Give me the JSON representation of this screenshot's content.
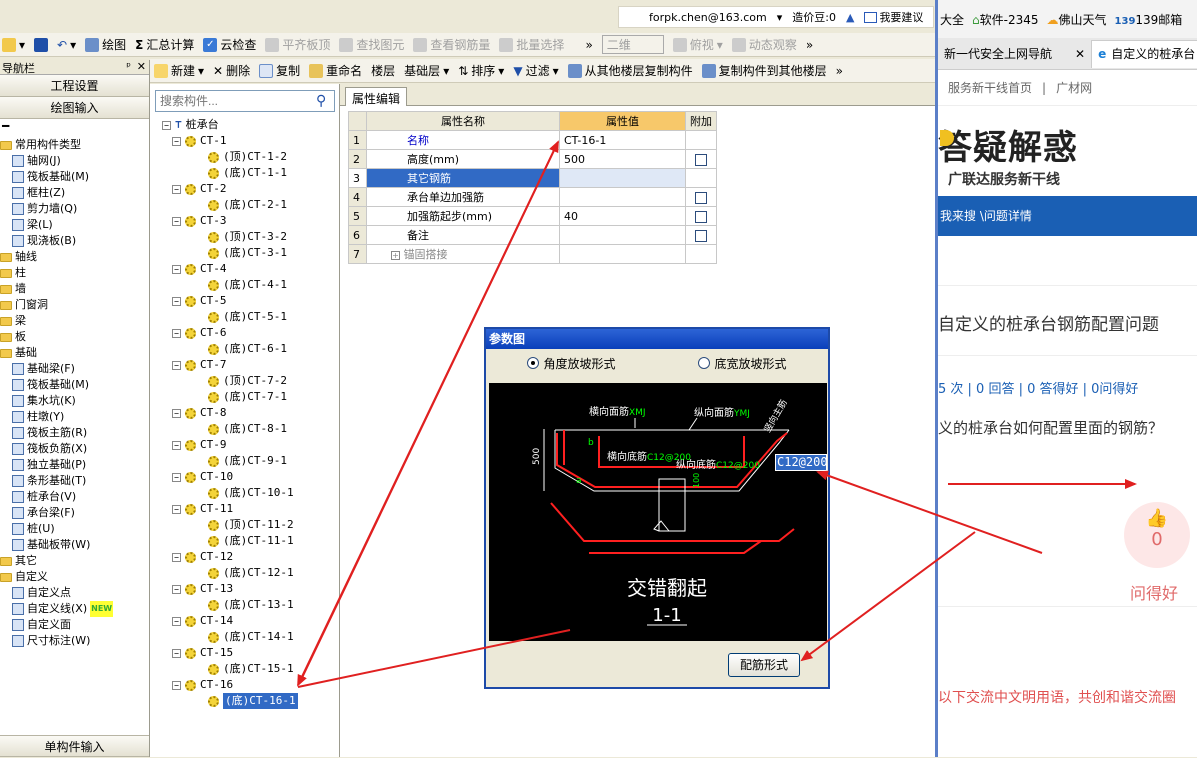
{
  "app": {
    "account": "forpk.chen@163.com",
    "price_beans": "造价豆:0",
    "suggest": "我要建议"
  },
  "toolbar1": {
    "items": [
      "绘图",
      "汇总计算",
      "云检查",
      "平齐板顶",
      "查找图元",
      "查看钢筋量",
      "批量选择"
    ],
    "view2d": "二维",
    "view_top": "俯视",
    "dynamic": "动态观察"
  },
  "toolbar2": {
    "items": [
      "新建",
      "删除",
      "复制",
      "重命名",
      "楼层",
      "基础层",
      "排序",
      "过滤",
      "从其他楼层复制构件",
      "复制构件到其他楼层"
    ]
  },
  "left_panel": {
    "title": "导航栏",
    "btn_settings": "工程设置",
    "btn_draw": "绘图输入",
    "bottom_btn": "单构件输入",
    "tree": [
      {
        "label": "常用构件类型",
        "type": "folder"
      },
      {
        "label": "轴网(J)",
        "type": "item"
      },
      {
        "label": "筏板基础(M)",
        "type": "item"
      },
      {
        "label": "框柱(Z)",
        "type": "item"
      },
      {
        "label": "剪力墙(Q)",
        "type": "item"
      },
      {
        "label": "梁(L)",
        "type": "item"
      },
      {
        "label": "现浇板(B)",
        "type": "item"
      },
      {
        "label": "轴线",
        "type": "folder"
      },
      {
        "label": "柱",
        "type": "folder"
      },
      {
        "label": "墙",
        "type": "folder"
      },
      {
        "label": "门窗洞",
        "type": "folder"
      },
      {
        "label": "梁",
        "type": "folder"
      },
      {
        "label": "板",
        "type": "folder"
      },
      {
        "label": "基础",
        "type": "folder"
      },
      {
        "label": "基础梁(F)",
        "type": "item"
      },
      {
        "label": "筏板基础(M)",
        "type": "item"
      },
      {
        "label": "集水坑(K)",
        "type": "item"
      },
      {
        "label": "柱墩(Y)",
        "type": "item"
      },
      {
        "label": "筏板主筋(R)",
        "type": "item"
      },
      {
        "label": "筏板负筋(X)",
        "type": "item"
      },
      {
        "label": "独立基础(P)",
        "type": "item"
      },
      {
        "label": "条形基础(T)",
        "type": "item"
      },
      {
        "label": "桩承台(V)",
        "type": "item"
      },
      {
        "label": "承台梁(F)",
        "type": "item"
      },
      {
        "label": "桩(U)",
        "type": "item"
      },
      {
        "label": "基础板带(W)",
        "type": "item"
      },
      {
        "label": "其它",
        "type": "folder"
      },
      {
        "label": "自定义",
        "type": "folder"
      },
      {
        "label": "自定义点",
        "type": "item"
      },
      {
        "label": "自定义线(X)",
        "type": "item"
      },
      {
        "label": "自定义面",
        "type": "item"
      },
      {
        "label": "尺寸标注(W)",
        "type": "item"
      }
    ],
    "new_badge": "NEW"
  },
  "component_panel": {
    "search_placeholder": "搜索构件...",
    "root": "桩承台",
    "rows": [
      {
        "label": "CT-1",
        "level": 1
      },
      {
        "label": "(顶)CT-1-2",
        "level": 2
      },
      {
        "label": "(底)CT-1-1",
        "level": 2
      },
      {
        "label": "CT-2",
        "level": 1
      },
      {
        "label": "(底)CT-2-1",
        "level": 2
      },
      {
        "label": "CT-3",
        "level": 1
      },
      {
        "label": "(顶)CT-3-2",
        "level": 2
      },
      {
        "label": "(底)CT-3-1",
        "level": 2
      },
      {
        "label": "CT-4",
        "level": 1
      },
      {
        "label": "(底)CT-4-1",
        "level": 2
      },
      {
        "label": "CT-5",
        "level": 1
      },
      {
        "label": "(底)CT-5-1",
        "level": 2
      },
      {
        "label": "CT-6",
        "level": 1
      },
      {
        "label": "(底)CT-6-1",
        "level": 2
      },
      {
        "label": "CT-7",
        "level": 1
      },
      {
        "label": "(顶)CT-7-2",
        "level": 2
      },
      {
        "label": "(底)CT-7-1",
        "level": 2
      },
      {
        "label": "CT-8",
        "level": 1
      },
      {
        "label": "(底)CT-8-1",
        "level": 2
      },
      {
        "label": "CT-9",
        "level": 1
      },
      {
        "label": "(底)CT-9-1",
        "level": 2
      },
      {
        "label": "CT-10",
        "level": 1
      },
      {
        "label": "(底)CT-10-1",
        "level": 2
      },
      {
        "label": "CT-11",
        "level": 1
      },
      {
        "label": "(顶)CT-11-2",
        "level": 2
      },
      {
        "label": "(底)CT-11-1",
        "level": 2
      },
      {
        "label": "CT-12",
        "level": 1
      },
      {
        "label": "(底)CT-12-1",
        "level": 2
      },
      {
        "label": "CT-13",
        "level": 1
      },
      {
        "label": "(底)CT-13-1",
        "level": 2
      },
      {
        "label": "CT-14",
        "level": 1
      },
      {
        "label": "(底)CT-14-1",
        "level": 2
      },
      {
        "label": "CT-15",
        "level": 1
      },
      {
        "label": "(底)CT-15-1",
        "level": 2
      },
      {
        "label": "CT-16",
        "level": 1
      },
      {
        "label": "(底)CT-16-1",
        "level": 2,
        "selected": true
      }
    ]
  },
  "properties": {
    "tab": "属性编辑",
    "headers": [
      "属性名称",
      "属性值",
      "附加"
    ],
    "rows": [
      {
        "n": "1",
        "name": "名称",
        "value": "CT-16-1",
        "check": false
      },
      {
        "n": "2",
        "name": "高度(mm)",
        "value": "500",
        "check": true
      },
      {
        "n": "3",
        "name": "其它钢筋",
        "value": "",
        "check": false,
        "selected": true
      },
      {
        "n": "4",
        "name": "承台单边加强筋",
        "value": "",
        "check": true
      },
      {
        "n": "5",
        "name": "加强筋起步(mm)",
        "value": "40",
        "check": true
      },
      {
        "n": "6",
        "name": "备注",
        "value": "",
        "check": true
      },
      {
        "n": "7",
        "name": "锚固搭接",
        "value": "",
        "check": false,
        "expand": true
      }
    ]
  },
  "dialog": {
    "title": "参数图",
    "radio1": "角度放坡形式",
    "radio2": "底宽放坡形式",
    "label_hmj": "横向面筋",
    "label_hmj_sub": "XMJ",
    "label_zmj": "纵向面筋",
    "label_zmj_sub": "YMJ",
    "label_xdj": "横向底筋",
    "label_xdj_val": "C12@200",
    "label_zdj": "纵向底筋",
    "label_zdj_val": "C12@200",
    "label_side": "竖向主筋",
    "label_500": "500",
    "label_100": "100",
    "label_a": "a",
    "label_b": "b",
    "edit_value": "C12@200",
    "caption": "交错翻起",
    "section": "1-1",
    "btn": "配筋形式"
  },
  "browser": {
    "bookmarks": [
      "大全",
      "软件-2345",
      "佛山天气",
      "139邮箱"
    ],
    "tab1": "新一代安全上网导航",
    "tab2": "自定义的桩承台",
    "nav1": "服务新干线首页",
    "nav2": "广材网",
    "logo_title": "答疑解惑",
    "logo_sub": "广联达服务新干线",
    "bluebar": "我来搜 \\问题详情",
    "question_title": "自定义的桩承台钢筋配置问题",
    "stats": "5 次 | 0 回答 | 0 答得好 | 0问得好",
    "question_body": "义的桩承台如何配置里面的钢筋？",
    "like_count": "0",
    "like_label": "问得好",
    "footer": "以下交流中文明用语，共创和谐交流圈"
  }
}
